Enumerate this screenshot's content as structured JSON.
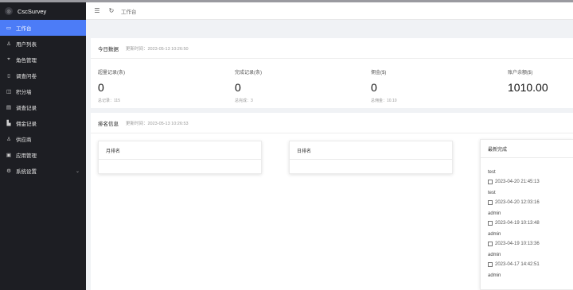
{
  "sidebar": {
    "brand": "CscSurvey",
    "items": [
      {
        "label": "工作台",
        "icon": "monitor-icon",
        "glyph": "▭"
      },
      {
        "label": "用户列表",
        "icon": "user-icon",
        "glyph": "♙"
      },
      {
        "label": "角色管理",
        "icon": "location-icon",
        "glyph": "⌖"
      },
      {
        "label": "调查问卷",
        "icon": "book-icon",
        "glyph": "▯"
      },
      {
        "label": "积分墙",
        "icon": "gift-icon",
        "glyph": "◫"
      },
      {
        "label": "调查记录",
        "icon": "clipboard-icon",
        "glyph": "▤"
      },
      {
        "label": "佣金记录",
        "icon": "thumbs-up-icon",
        "glyph": "▙"
      },
      {
        "label": "供应商",
        "icon": "supplier-icon",
        "glyph": "♙"
      },
      {
        "label": "应用管理",
        "icon": "app-icon",
        "glyph": "▣"
      },
      {
        "label": "系统设置",
        "icon": "gear-icon",
        "glyph": "⚙"
      }
    ]
  },
  "header": {
    "menu_icon": "☰",
    "refresh_icon": "↻",
    "breadcrumb": "工作台"
  },
  "today": {
    "title": "今日数据",
    "updated": "更新时间：2023-05-13 10:26:50",
    "stats": [
      {
        "label": "超量记录(条)",
        "value": "0",
        "sub": "总记录：115"
      },
      {
        "label": "完成记录(条)",
        "value": "0",
        "sub": "总完成：3"
      },
      {
        "label": "佣金($)",
        "value": "0",
        "sub": "总佣金：10.10"
      },
      {
        "label": "账户余额($)",
        "value": "1010.00",
        "sub": ""
      }
    ]
  },
  "ranking": {
    "title": "排名信息",
    "updated": "更新时间：2023-05-13 10:26:53",
    "panels": [
      {
        "title": "月排名"
      },
      {
        "title": "日排名"
      }
    ],
    "latest": {
      "title": "最新完成",
      "records": [
        {
          "name": "test",
          "date": "2023-04-20 21:45:13"
        },
        {
          "name": "test",
          "date": "2023-04-20 12:03:16"
        },
        {
          "name": "admin",
          "date": "2023-04-19 10:13:48"
        },
        {
          "name": "admin",
          "date": "2023-04-19 10:13:36"
        },
        {
          "name": "admin",
          "date": "2023-04-17 14:42:51"
        },
        {
          "name": "admin",
          "date": ""
        }
      ]
    }
  },
  "colors": {
    "sidebar_bg": "#1d1e23",
    "accent": "#4c7cf7",
    "page_bg": "#f0f2f5"
  }
}
